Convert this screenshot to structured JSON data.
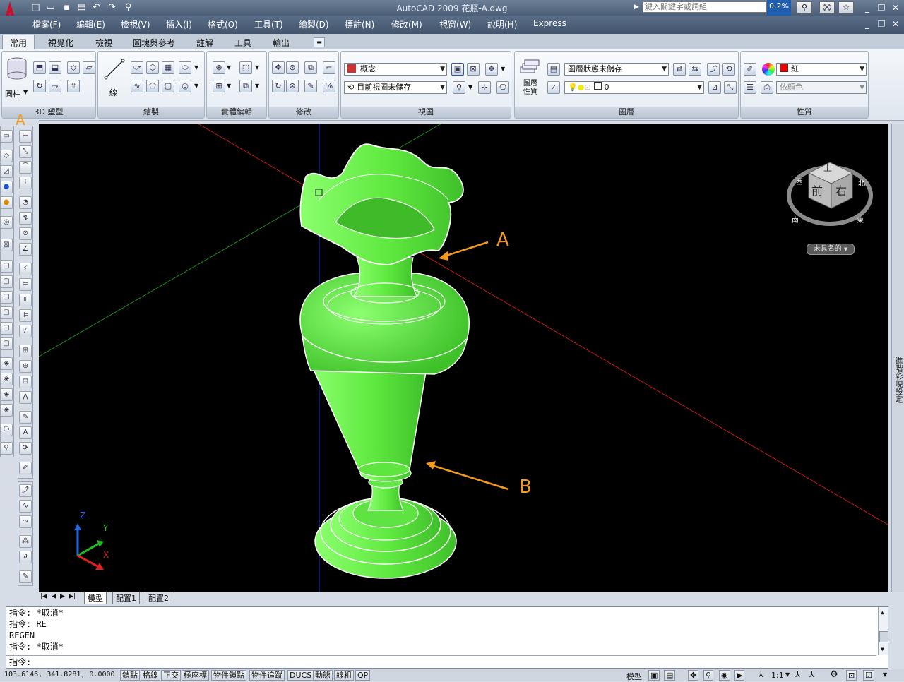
{
  "window": {
    "title": "AutoCAD 2009 花瓶-A.dwg",
    "search_placeholder": "鍵入關鍵字或詞組",
    "progress": "0.2%"
  },
  "menu": [
    "檔案(F)",
    "編輯(E)",
    "檢視(V)",
    "插入(I)",
    "格式(O)",
    "工具(T)",
    "繪製(D)",
    "標註(N)",
    "修改(M)",
    "視窗(W)",
    "說明(H)",
    "Express"
  ],
  "ribbon_tabs": [
    "常用",
    "視覺化",
    "檢視",
    "圖塊與參考",
    "註解",
    "工具",
    "輸出"
  ],
  "panels": {
    "modeling": {
      "title": "3D 塑型",
      "cylinder_label": "圓柱"
    },
    "draw": {
      "title": "繪製",
      "line_label": "線"
    },
    "solid_edit": {
      "title": "實體編輯"
    },
    "modify": {
      "title": "修改"
    },
    "view": {
      "title": "視圖",
      "visual_style": "概念",
      "named_view": "目前視圖未儲存"
    },
    "layers": {
      "title": "圖層",
      "layer_state": "圖層狀態未儲存",
      "current_layer": "0",
      "layer_props_label": "圖層\n性質"
    },
    "properties": {
      "title": "性質",
      "color": "紅",
      "linetype": "依顏色"
    }
  },
  "viewport": {
    "annotations": [
      {
        "label": "A"
      },
      {
        "label": "B"
      }
    ],
    "toolbar_marker": "A",
    "viewcube": {
      "top": "上",
      "front": "前",
      "right": "右",
      "north": "北",
      "west": "西",
      "east": "東",
      "south": "南",
      "ucs_label": "未具名的"
    },
    "ucs_axes": {
      "x": "X",
      "y": "Y",
      "z": "Z"
    },
    "object_color": "#66ee44"
  },
  "layout_tabs": [
    "模型",
    "配置1",
    "配置2"
  ],
  "command_history": [
    "指令: *取消*",
    "指令: RE",
    "REGEN",
    "指令: *取消*"
  ],
  "command_prompt": "指令:",
  "status": {
    "coords": "103.6146, 341.8281, 0.0000",
    "toggles": [
      "鎖點",
      "格線",
      "正交",
      "極座標",
      "物件鎖點",
      "物件追蹤",
      "DUCS",
      "動態",
      "線粗",
      "QP"
    ],
    "model_label": "模型",
    "scale": "1:1"
  },
  "right_strip_label": "進階彩現設定"
}
